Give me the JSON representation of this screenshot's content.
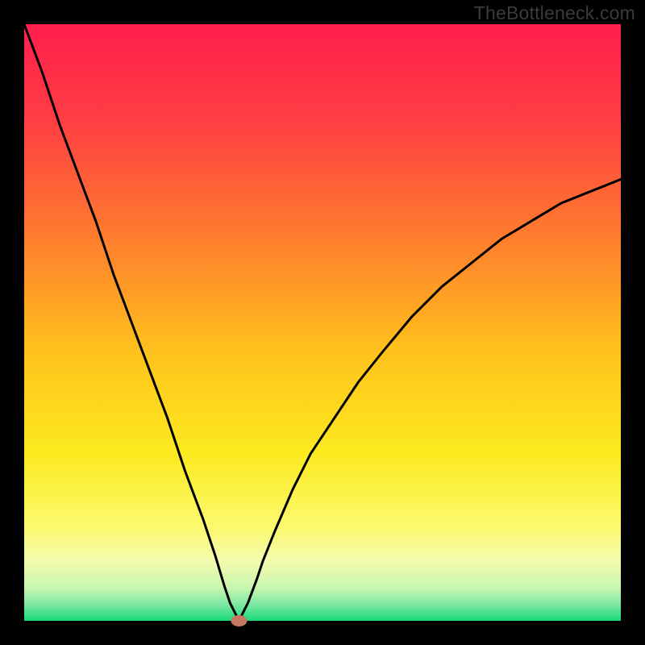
{
  "watermark": "TheBottleneck.com",
  "chart_data": {
    "type": "line",
    "title": "",
    "xlabel": "",
    "ylabel": "",
    "xlim": [
      0,
      100
    ],
    "ylim": [
      0,
      100
    ],
    "grid": false,
    "legend": false,
    "marker": {
      "x": 36,
      "y": 0
    },
    "series": [
      {
        "name": "bottleneck-curve",
        "x": [
          0,
          3,
          6,
          9,
          12,
          15,
          18,
          21,
          24,
          27,
          30,
          32,
          33.5,
          34.5,
          35.5,
          36,
          36.5,
          37.5,
          39,
          40,
          42,
          45,
          48,
          52,
          56,
          60,
          65,
          70,
          75,
          80,
          85,
          90,
          95,
          100
        ],
        "y": [
          100,
          92,
          83,
          75,
          67,
          58,
          50,
          42,
          34,
          25,
          17,
          11,
          6,
          3,
          1,
          0,
          1,
          3,
          7,
          10,
          15,
          22,
          28,
          34,
          40,
          45,
          51,
          56,
          60,
          64,
          67,
          70,
          72,
          74
        ]
      }
    ],
    "background_gradient": {
      "stops": [
        {
          "offset": 0.0,
          "color": "#ff1f4c"
        },
        {
          "offset": 0.15,
          "color": "#ff3b44"
        },
        {
          "offset": 0.35,
          "color": "#ff7a2f"
        },
        {
          "offset": 0.55,
          "color": "#ffc21c"
        },
        {
          "offset": 0.72,
          "color": "#fcea1f"
        },
        {
          "offset": 0.84,
          "color": "#fdf96d"
        },
        {
          "offset": 0.9,
          "color": "#f4fbad"
        },
        {
          "offset": 0.945,
          "color": "#c7f6b0"
        },
        {
          "offset": 0.972,
          "color": "#7fe9a3"
        },
        {
          "offset": 1.0,
          "color": "#17d977"
        }
      ]
    },
    "frame_color": "#000000",
    "curve_color": "#000000",
    "marker_color": "#c77860"
  }
}
